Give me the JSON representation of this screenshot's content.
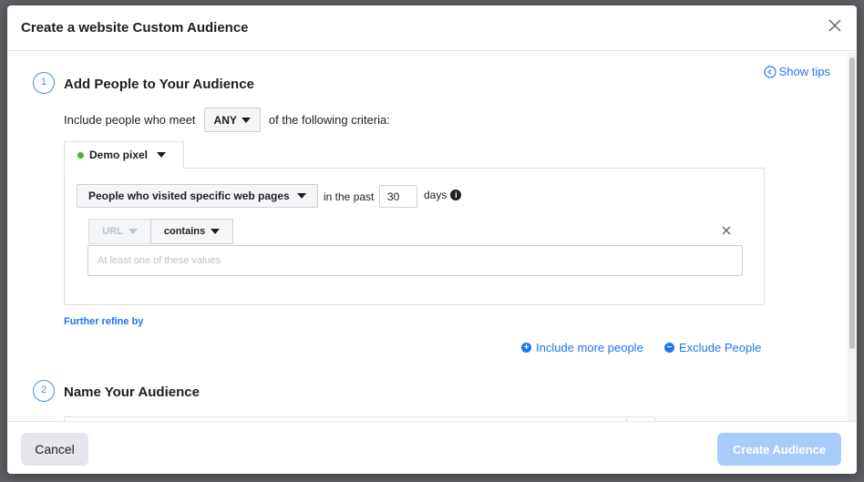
{
  "dialog": {
    "title": "Create a website Custom Audience",
    "close_icon": "close-icon"
  },
  "show_tips": {
    "label": "Show tips",
    "icon": "chevron-left-circle-icon"
  },
  "step1": {
    "number": "1",
    "title": "Add People to Your Audience",
    "criteria_prefix": "Include people who meet",
    "match_selector": "ANY",
    "criteria_suffix": "of the following criteria:"
  },
  "pixel": {
    "name": "Demo pixel",
    "status_color": "#42b72a"
  },
  "rule": {
    "event_selector": "People who visited specific web pages",
    "in_the_past": "in the past",
    "days_value": "30",
    "days_label": "days",
    "field_selector": "URL",
    "operator_selector": "contains",
    "value_placeholder": "At least one of these values"
  },
  "further_refine": "Further refine by",
  "actions": {
    "include_more": "Include more people",
    "exclude": "Exclude People"
  },
  "step2": {
    "number": "2",
    "title": "Name Your Audience"
  },
  "footer": {
    "cancel": "Cancel",
    "create": "Create Audience"
  },
  "colors": {
    "accent": "#1877f2",
    "step_circle": "#4a90e2",
    "primary_disabled": "#a9cdf9"
  }
}
